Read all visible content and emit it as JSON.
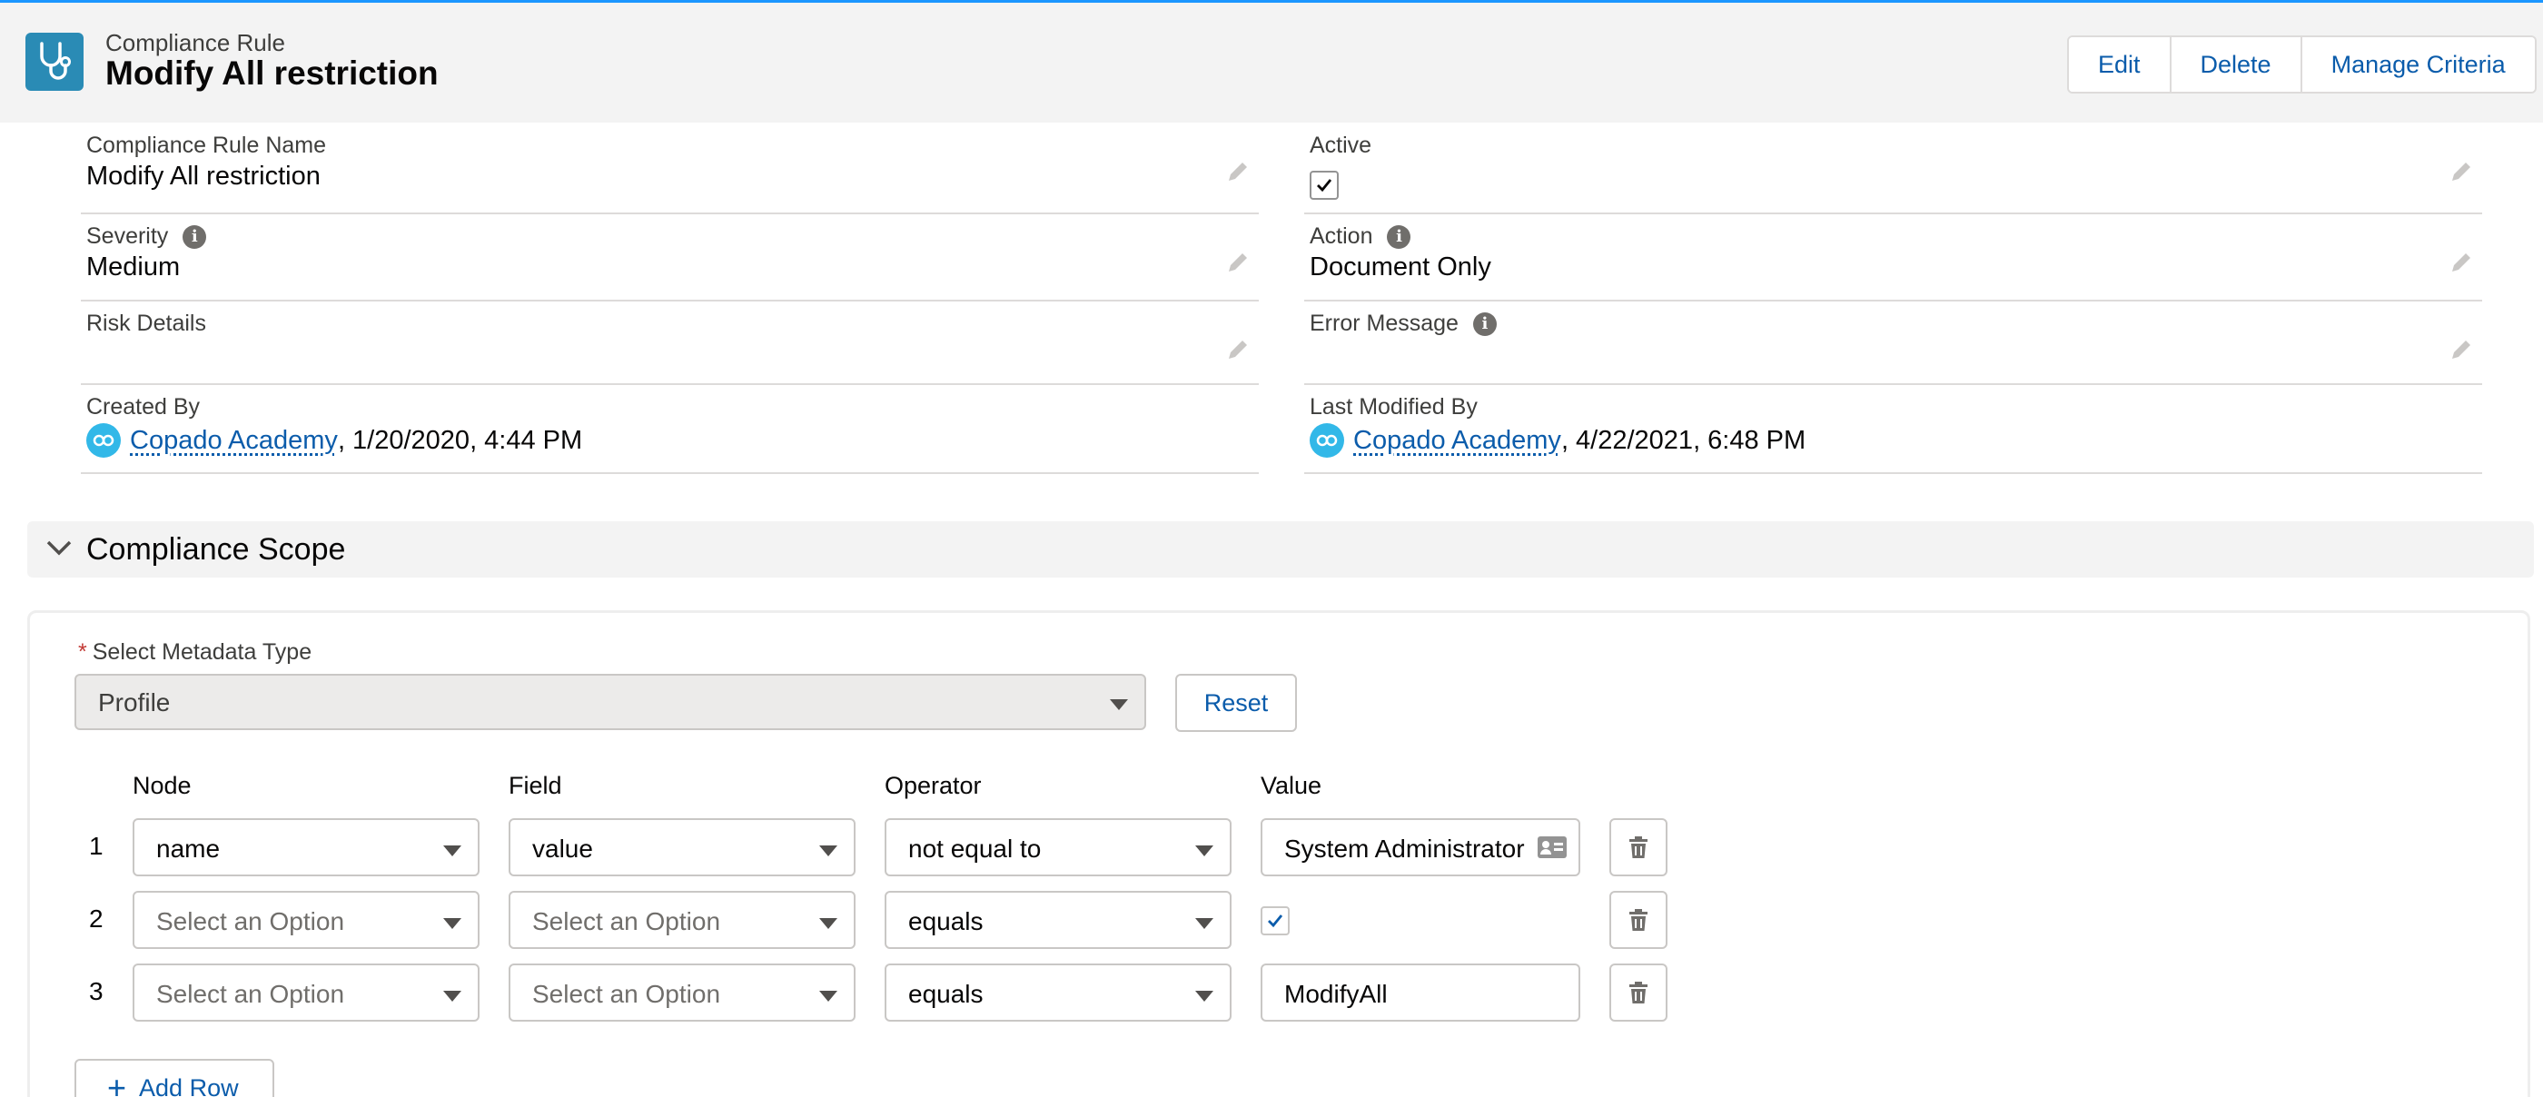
{
  "header": {
    "object_type": "Compliance Rule",
    "title": "Modify All restriction",
    "icon": "stethoscope-icon",
    "actions": [
      "Edit",
      "Delete",
      "Manage Criteria"
    ]
  },
  "details": {
    "rule_name": {
      "label": "Compliance Rule Name",
      "value": "Modify All restriction"
    },
    "active": {
      "label": "Active",
      "checked": true
    },
    "severity": {
      "label": "Severity",
      "value": "Medium"
    },
    "action": {
      "label": "Action",
      "value": "Document Only"
    },
    "risk_details": {
      "label": "Risk Details",
      "value": ""
    },
    "error_message": {
      "label": "Error Message",
      "value": ""
    },
    "created_by": {
      "label": "Created By",
      "user": "Copado Academy",
      "date": ", 1/20/2020, 4:44 PM"
    },
    "last_modified_by": {
      "label": "Last Modified By",
      "user": "Copado Academy",
      "date": ", 4/22/2021, 6:48 PM"
    }
  },
  "scope": {
    "title": "Compliance Scope",
    "metadata_label": "Select Metadata Type",
    "required_mark": "*",
    "metadata_value": "Profile",
    "reset_label": "Reset",
    "columns": {
      "node": "Node",
      "field": "Field",
      "operator": "Operator",
      "value": "Value"
    },
    "rows": [
      {
        "num": "1",
        "node": "name",
        "field": "value",
        "operator": "not equal to",
        "value": "System Administrator"
      },
      {
        "num": "2",
        "node": "Select an Option",
        "field": "Select an Option",
        "operator": "equals",
        "value_checked": true
      },
      {
        "num": "3",
        "node": "Select an Option",
        "field": "Select an Option",
        "operator": "equals",
        "value": "ModifyAll"
      }
    ],
    "add_row_label": "Add Row"
  },
  "colors": {
    "link": "#0b5cab",
    "header_bg": "#f3f3f3",
    "icon_bg": "#2a8bb5",
    "avatar": "#32b8e8"
  }
}
